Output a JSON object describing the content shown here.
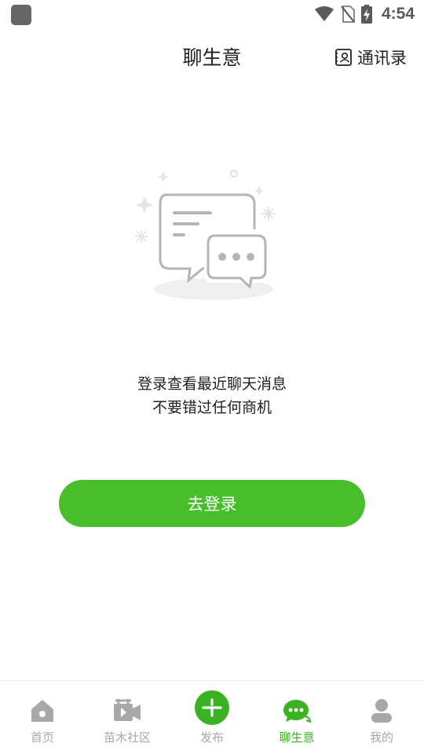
{
  "status_bar": {
    "time": "4:54"
  },
  "header": {
    "title": "聊生意",
    "contacts_label": "通讯录"
  },
  "empty_state": {
    "line1": "登录查看最近聊天消息",
    "line2": "不要错过任何商机",
    "login_button": "去登录"
  },
  "bottom_nav": {
    "items": [
      {
        "label": "首页",
        "icon": "home-icon"
      },
      {
        "label": "苗木社区",
        "icon": "video-community-icon"
      },
      {
        "label": "发布",
        "icon": "publish-plus-icon"
      },
      {
        "label": "聊生意",
        "icon": "chat-icon",
        "active": true
      },
      {
        "label": "我的",
        "icon": "profile-icon"
      }
    ]
  },
  "colors": {
    "accent": "#47be2a",
    "nav_inactive": "#a8a8a8",
    "nav_active": "#3bb223"
  }
}
